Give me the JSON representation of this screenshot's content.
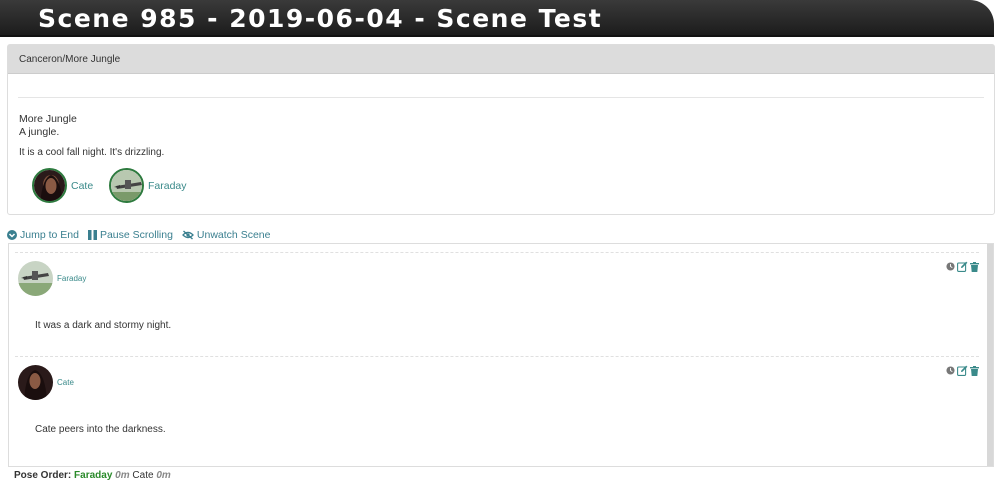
{
  "scene": {
    "title": "Scene 985 - 2019-06-04 - Scene Test",
    "location_path": "Canceron/More Jungle",
    "location_name": "More Jungle",
    "location_desc": "A jungle.",
    "weather": "It is a cool fall night.  It's drizzling."
  },
  "participants": [
    {
      "name": "Cate",
      "icon": "cate-avatar"
    },
    {
      "name": "Faraday",
      "icon": "faraday-avatar"
    }
  ],
  "controls": {
    "jump_to_end": "Jump to End",
    "pause_scrolling": "Pause Scrolling",
    "unwatch_scene": "Unwatch Scene"
  },
  "poses": [
    {
      "author": "Faraday",
      "text": "It was a dark and stormy night.",
      "icon": "faraday-avatar"
    },
    {
      "author": "Cate",
      "text": "Cate peers into the darkness.",
      "icon": "cate-avatar"
    }
  ],
  "pose_order": {
    "label": "Pose Order:",
    "entries": [
      {
        "name": "Faraday",
        "time": "0m"
      },
      {
        "name": "Cate",
        "time": "0m"
      }
    ]
  },
  "colors": {
    "link": "#3a8a8a",
    "active_green": "#2a8a2a",
    "title_bar": "#2a2a2a"
  }
}
